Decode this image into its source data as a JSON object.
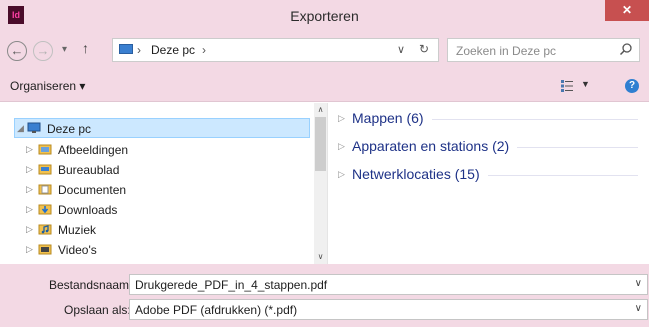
{
  "window": {
    "title": "Exporteren",
    "app_icon_text": "Id",
    "close_glyph": "✕"
  },
  "nav": {
    "back_glyph": "←",
    "forward_glyph": "→",
    "history_glyph": "▾",
    "up_glyph": "↑",
    "breadcrumb_sep": "›",
    "breadcrumb_item": "Deze pc",
    "dropdown_glyph": "∨",
    "refresh_glyph": "↻",
    "search_placeholder": "Zoeken in Deze pc"
  },
  "toolbar": {
    "organise_label": "Organiseren ▾",
    "view_arrow": "▼",
    "help_glyph": "?"
  },
  "tree": {
    "root": {
      "label": "Deze pc",
      "icon": "pc-icon",
      "expanded_glyph": "◢"
    },
    "items": [
      {
        "label": "Afbeeldingen",
        "icon": "pictures-folder-icon",
        "arrow": "▷"
      },
      {
        "label": "Bureaublad",
        "icon": "desktop-folder-icon",
        "arrow": "▷"
      },
      {
        "label": "Documenten",
        "icon": "documents-folder-icon",
        "arrow": "▷"
      },
      {
        "label": "Downloads",
        "icon": "downloads-folder-icon",
        "arrow": "▷"
      },
      {
        "label": "Muziek",
        "icon": "music-folder-icon",
        "arrow": "▷"
      },
      {
        "label": "Video's",
        "icon": "videos-folder-icon",
        "arrow": "▷"
      }
    ]
  },
  "scrollbar": {
    "up_glyph": "∧",
    "down_glyph": "∨"
  },
  "groups": [
    {
      "label": "Mappen (6)",
      "arrow": "▷"
    },
    {
      "label": "Apparaten en stations (2)",
      "arrow": "▷"
    },
    {
      "label": "Netwerklocaties (15)",
      "arrow": "▷"
    }
  ],
  "form": {
    "filename_label": "Bestandsnaam:",
    "filename_value": "Drukgerede_PDF_in_4_stappen.pdf",
    "savetype_label": "Opslaan als:",
    "savetype_value": "Adobe PDF (afdrukken) (*.pdf)",
    "dropdown_glyph": "∨"
  },
  "colors": {
    "chrome": "#f3d9e4",
    "close": "#c75050",
    "link_blue": "#1e3287",
    "selection": "#cce8ff"
  }
}
